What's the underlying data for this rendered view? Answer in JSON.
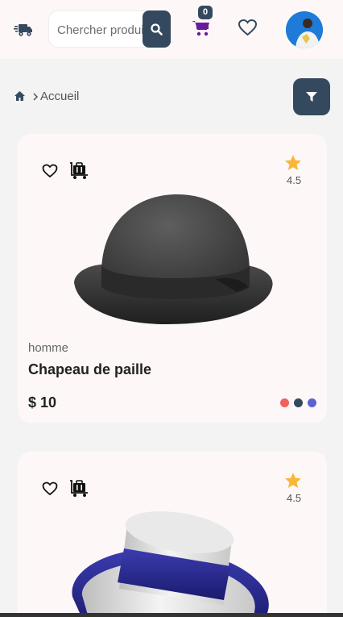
{
  "header": {
    "search": {
      "placeholder": "Chercher produit",
      "value": ""
    },
    "cart_count": "0",
    "icons": [
      "truck-icon",
      "search-icon",
      "cart-icon",
      "heart-icon",
      "avatar"
    ]
  },
  "breadcrumb": {
    "home_icon": "home-icon",
    "current": "Accueil"
  },
  "products": [
    {
      "category": "homme",
      "name": "Chapeau de paille",
      "price": "$ 10",
      "rating": "4.5",
      "colors": [
        "#f0625d",
        "#34495e",
        "#5a63cf"
      ]
    },
    {
      "rating": "4.5"
    }
  ],
  "colors": {
    "accent": "#34495e",
    "cart": "#6a1b9a",
    "star": "#f9b73a"
  }
}
